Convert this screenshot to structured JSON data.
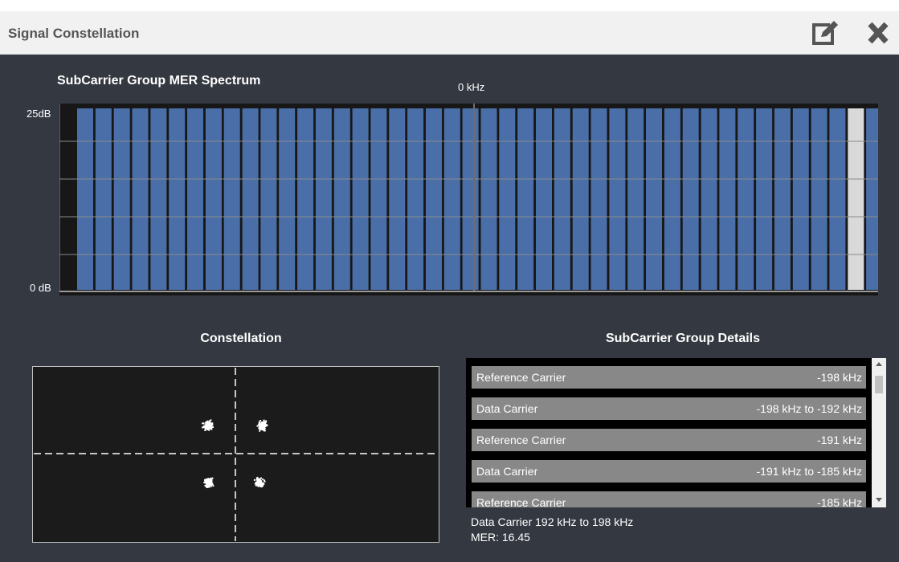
{
  "window": {
    "title": "Signal Constellation",
    "edit_icon": "edit-icon",
    "close_icon": "close-icon"
  },
  "spectrum": {
    "title": "SubCarrier Group MER Spectrum",
    "center_label": "0 kHz",
    "y_top_label": "25dB",
    "y_bottom_label": "0 dB",
    "bar_count": 44,
    "selected_bar_index": 42,
    "bar_color": "#4a6fa8",
    "selected_color": "#d9d9d9"
  },
  "constellation": {
    "title": "Constellation"
  },
  "details": {
    "title": "SubCarrier Group Details",
    "rows": [
      {
        "label": "Reference Carrier",
        "value": "-198 kHz"
      },
      {
        "label": "Data Carrier",
        "value": "-198 kHz to -192 kHz"
      },
      {
        "label": "Reference Carrier",
        "value": "-191 kHz"
      },
      {
        "label": "Data Carrier",
        "value": "-191 kHz to -185 kHz"
      },
      {
        "label": "Reference Carrier",
        "value": "-185 kHz"
      }
    ],
    "selected_info": "Data Carrier 192 kHz to 198 kHz",
    "mer": "MER: 16.45"
  }
}
